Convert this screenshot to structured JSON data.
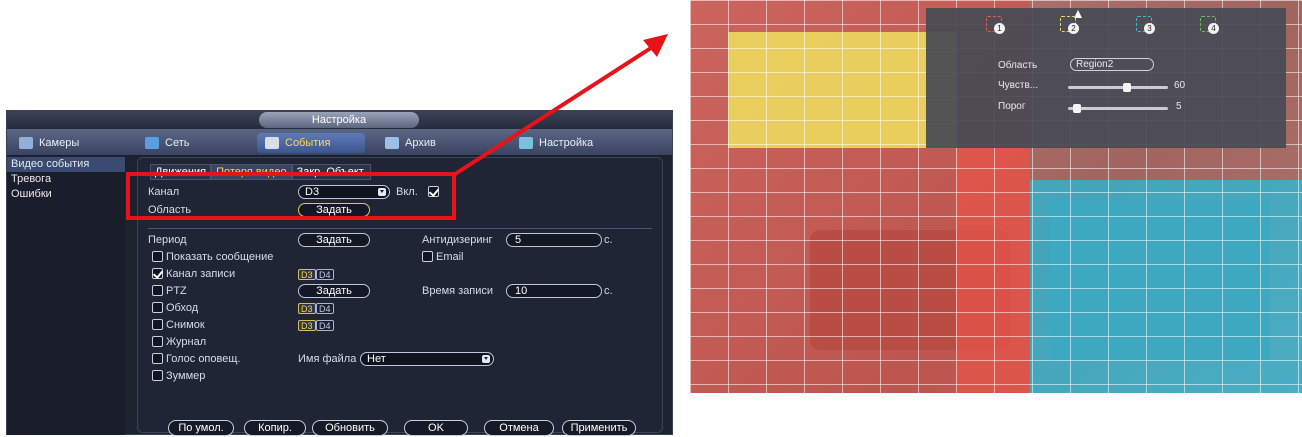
{
  "window": {
    "title": "Настройка"
  },
  "topnav": [
    {
      "label": "Камеры",
      "icon": "camera-icon",
      "active": false
    },
    {
      "label": "Сеть",
      "icon": "network-icon",
      "active": false
    },
    {
      "label": "События",
      "icon": "events-icon",
      "active": true
    },
    {
      "label": "Архив",
      "icon": "archive-icon",
      "active": false
    },
    {
      "label": "Настройка",
      "icon": "settings-icon",
      "active": false
    }
  ],
  "sidebar": [
    {
      "label": "Видео события",
      "active": true
    },
    {
      "label": "Тревога",
      "active": false
    },
    {
      "label": "Ошибки",
      "active": false
    }
  ],
  "subtabs": [
    {
      "label": "Движения",
      "active": true
    },
    {
      "label": "Потеря видео",
      "active": false
    },
    {
      "label": "Закр. Объект.",
      "active": false
    }
  ],
  "form": {
    "channel_label": "Канал",
    "channel_value": "D3",
    "enable_label": "Вкл.",
    "enable_checked": true,
    "area_label": "Область",
    "area_button": "Задать",
    "period_label": "Период",
    "period_button": "Задать",
    "anti_dither_label": "Антидизеринг",
    "anti_dither_value": "5",
    "anti_dither_unit": "с.",
    "show_message_label": "Показать сообщение",
    "show_message_checked": false,
    "email_label": "Email",
    "email_checked": false,
    "record_channel_label": "Канал записи",
    "record_channel_checked": true,
    "record_channels": [
      {
        "label": "D3",
        "on": true
      },
      {
        "label": "D4",
        "on": false
      }
    ],
    "ptz_label": "PTZ",
    "ptz_checked": false,
    "ptz_button": "Задать",
    "record_time_label": "Время записи",
    "record_time_value": "10",
    "record_time_unit": "с.",
    "tour_label": "Обход",
    "tour_checked": false,
    "tour_channels": [
      {
        "label": "D3",
        "on": true
      },
      {
        "label": "D4",
        "on": false
      }
    ],
    "snapshot_label": "Снимок",
    "snapshot_checked": false,
    "snapshot_channels": [
      {
        "label": "D3",
        "on": true
      },
      {
        "label": "D4",
        "on": false
      }
    ],
    "log_label": "Журнал",
    "log_checked": false,
    "voice_label": "Голос оповещ.",
    "voice_checked": false,
    "file_name_label": "Имя файла",
    "file_name_value": "Нет",
    "buzzer_label": "Зуммер",
    "buzzer_checked": false
  },
  "footer": {
    "default": "По умол.",
    "copy": "Копир.",
    "refresh": "Обновить",
    "ok": "OK",
    "cancel": "Отмена",
    "apply": "Применить"
  },
  "camera_overlay": {
    "regions": [
      {
        "num": "1",
        "color": "#e06050"
      },
      {
        "num": "2",
        "color": "#e8d860"
      },
      {
        "num": "3",
        "color": "#4fb3c8"
      },
      {
        "num": "4",
        "color": "#67c34f"
      }
    ],
    "region_label": "Область",
    "region_value": "Region2",
    "sensitivity_label": "Чувств...",
    "sensitivity_value": "60",
    "threshold_label": "Порог",
    "threshold_value": "5",
    "sensitivity_level": 0.6,
    "threshold_level": 0.05
  },
  "colors": {
    "highlight_red": "#e8121b",
    "active_tab_text": "#ffd54a",
    "zone_red": "#e0604f",
    "zone_yellow": "#e6dc5a",
    "zone_cyan": "#3fb8cf"
  }
}
